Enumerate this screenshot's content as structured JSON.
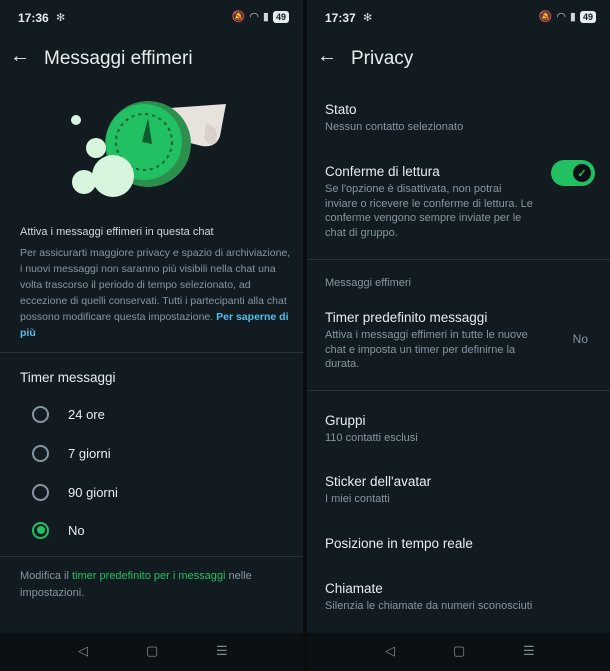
{
  "left": {
    "status": {
      "time": "17:36",
      "battery": "49"
    },
    "title": "Messaggi effimeri",
    "heading": "Attiva i messaggi effimeri in questa chat",
    "body": "Per assicurarti maggiore privacy e spazio di archiviazione, i nuovi messaggi non saranno più visibili nella chat una volta trascorso il periodo di tempo selezionato, ad eccezione di quelli conservati. Tutti i partecipanti alla chat possono modificare questa impostazione.",
    "learn_more": "Per saperne di più",
    "timer_label": "Timer messaggi",
    "options": [
      {
        "label": "24 ore",
        "selected": false
      },
      {
        "label": "7 giorni",
        "selected": false
      },
      {
        "label": "90 giorni",
        "selected": false
      },
      {
        "label": "No",
        "selected": true
      }
    ],
    "footer_prefix": "Modifica il ",
    "footer_link": "timer predefinito per i messaggi",
    "footer_suffix": " nelle impostazioni."
  },
  "right": {
    "status": {
      "time": "17:37",
      "battery": "49"
    },
    "title": "Privacy",
    "stato": {
      "title": "Stato",
      "sub": "Nessun contatto selezionato"
    },
    "conferme": {
      "title": "Conferme di lettura",
      "sub": "Se l'opzione è disattivata, non potrai inviare o ricevere le conferme di lettura. Le conferme vengono sempre inviate per le chat di gruppo.",
      "enabled": true
    },
    "section_effimeri": "Messaggi effimeri",
    "timer": {
      "title": "Timer predefinito messaggi",
      "sub": "Attiva i messaggi effimeri in tutte le nuove chat e imposta un timer per definirne la durata.",
      "value": "No"
    },
    "gruppi": {
      "title": "Gruppi",
      "sub": "110 contatti esclusi"
    },
    "sticker": {
      "title": "Sticker dell'avatar",
      "sub": "I miei contatti"
    },
    "posizione": {
      "title": "Posizione in tempo reale"
    },
    "chiamate": {
      "title": "Chiamate",
      "sub": "Silenzia le chiamate da numeri sconosciuti"
    }
  },
  "colors": {
    "accent": "#21c063",
    "link": "#53bdeb",
    "background": "#121b20"
  },
  "icons": [
    "back-arrow-icon",
    "toggle-check-icon",
    "nav-back-icon",
    "nav-home-icon",
    "nav-recents-icon"
  ]
}
